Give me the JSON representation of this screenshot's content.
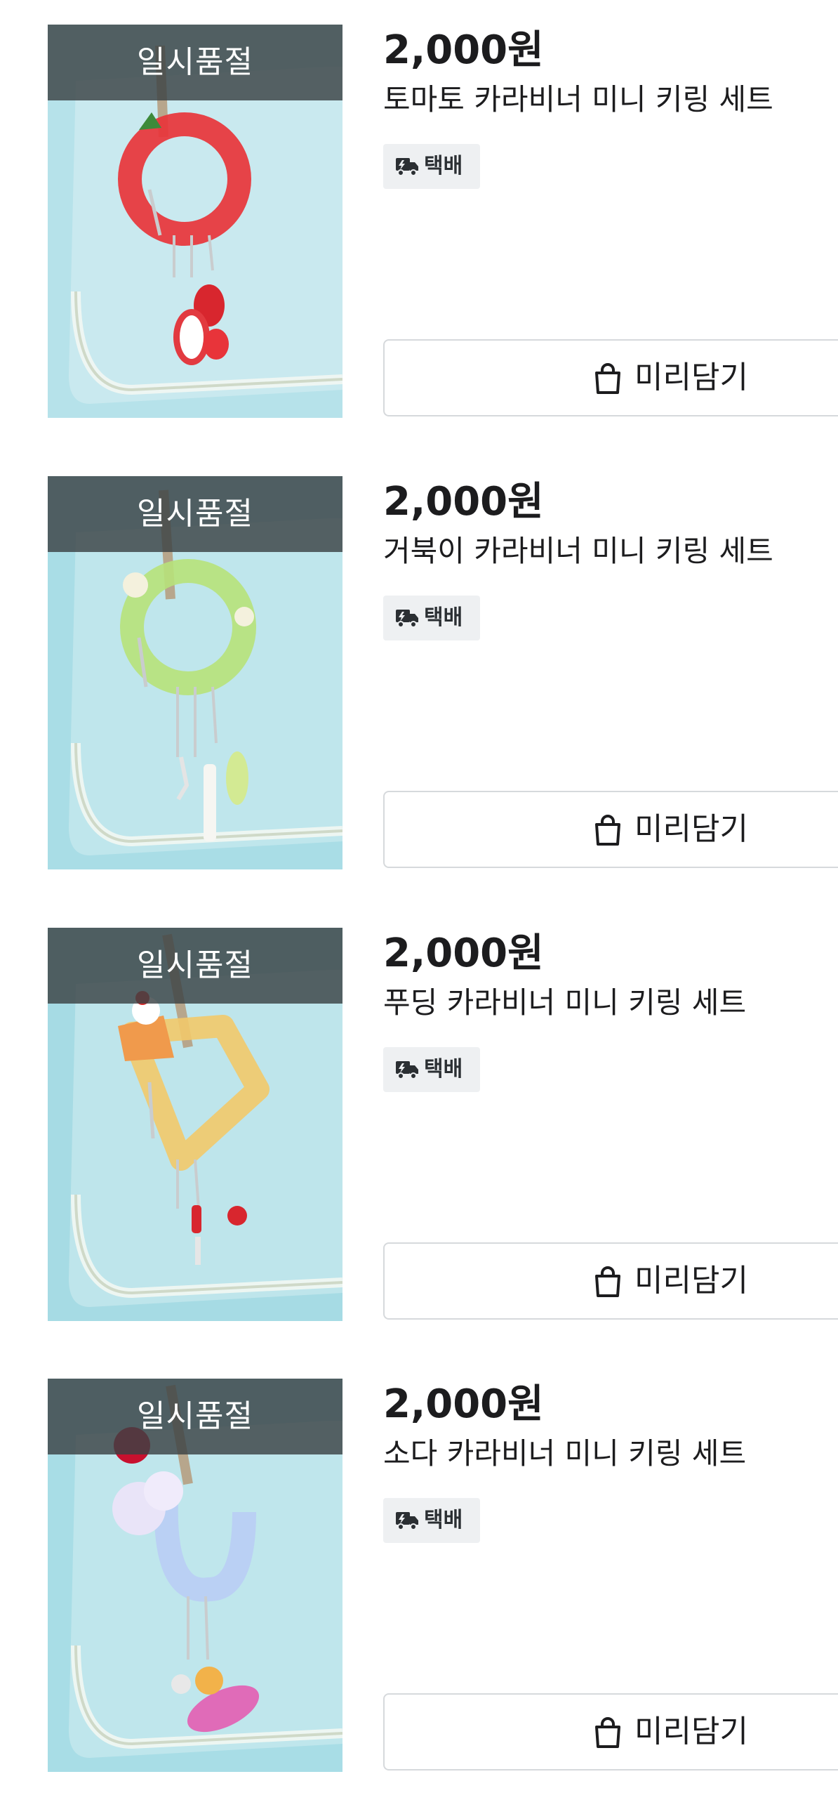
{
  "products": [
    {
      "soldout_label": "일시품절",
      "price": "2,000원",
      "title": "토마토 카라비너 미니 키링 세트",
      "badge": "택배",
      "button_label": "미리담기",
      "accent_color": "#e8343a"
    },
    {
      "soldout_label": "일시품절",
      "price": "2,000원",
      "title": "거북이 카라비너 미니 키링 세트",
      "badge": "택배",
      "button_label": "미리담기",
      "accent_color": "#b7e27a"
    },
    {
      "soldout_label": "일시품절",
      "price": "2,000원",
      "title": "푸딩 카라비너 미니 키링 세트",
      "badge": "택배",
      "button_label": "미리담기",
      "accent_color": "#f2b860"
    },
    {
      "soldout_label": "일시품절",
      "price": "2,000원",
      "title": "소다 카라비너 미니 키링 세트",
      "badge": "택배",
      "button_label": "미리담기",
      "accent_color": "#b9cdf5"
    }
  ],
  "icons": {
    "badge_icon": "delivery-truck-icon",
    "button_icon": "shopping-bag-icon"
  }
}
